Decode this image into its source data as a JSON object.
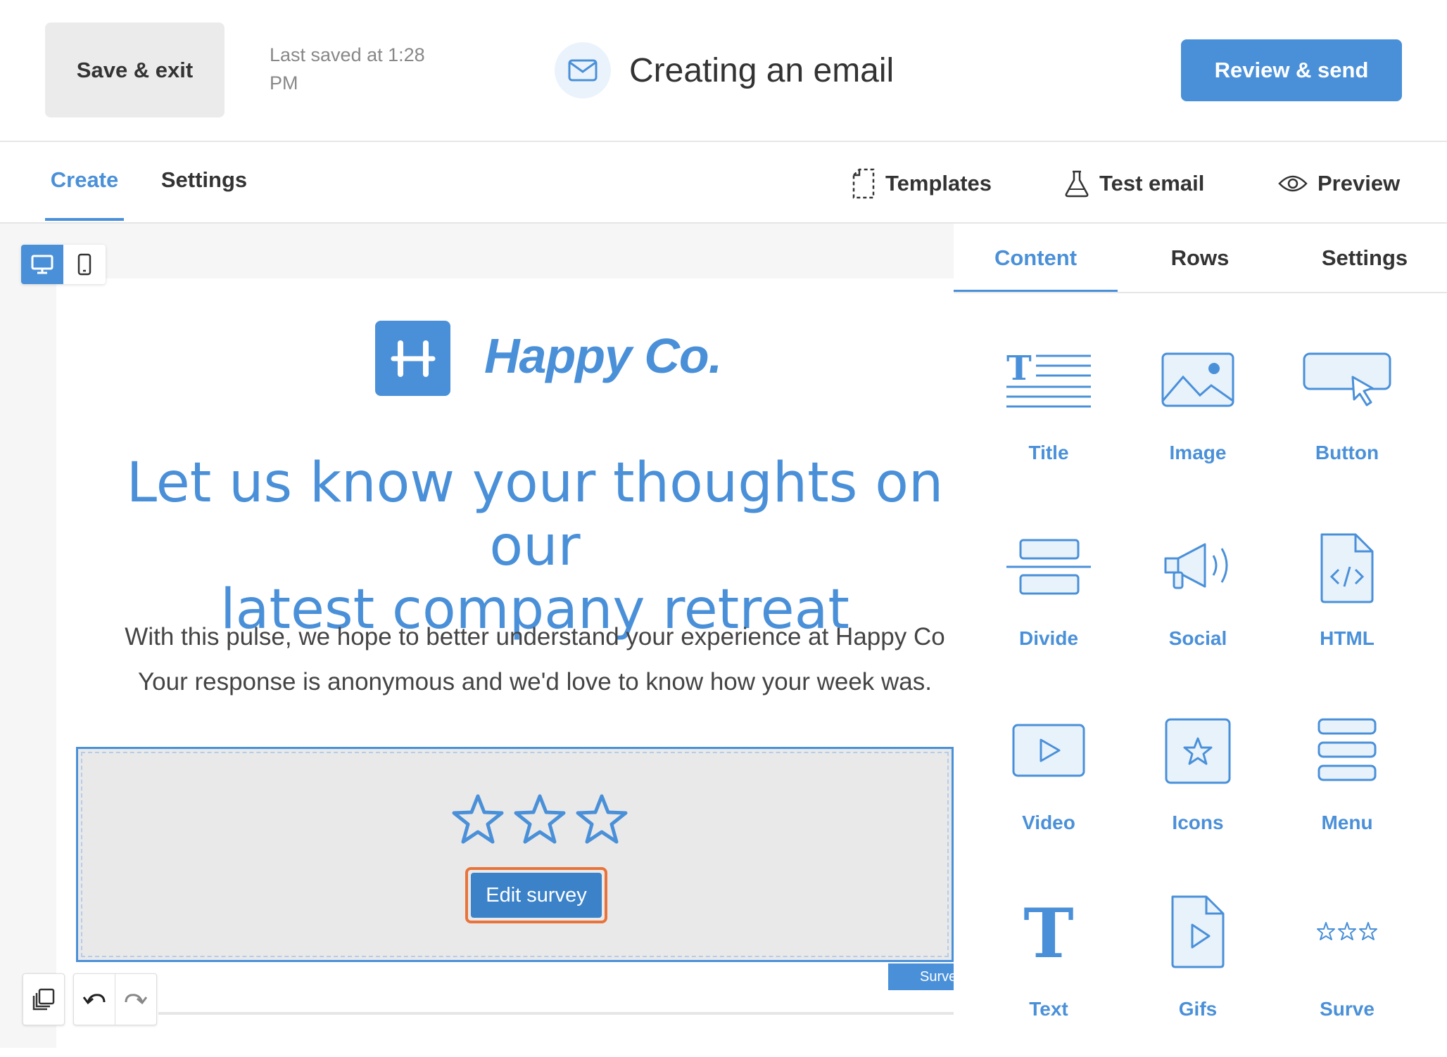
{
  "header": {
    "save_exit_label": "Save & exit",
    "last_saved": "Last saved at 1:28 PM",
    "title": "Creating an email",
    "review_send_label": "Review & send"
  },
  "tabs": {
    "create": "Create",
    "settings": "Settings"
  },
  "tools": {
    "templates": "Templates",
    "test_email": "Test email",
    "preview": "Preview"
  },
  "email": {
    "logo_text": "Happy Co.",
    "headline_line1": "Let us know your thoughts on our",
    "headline_line2": "latest company retreat",
    "body_line1": "With this pulse, we hope to better understand your experience at Happy Co",
    "body_line2": "Your response is anonymous and we'd love to know how your week was.",
    "edit_survey_label": "Edit survey",
    "survey_tag": "Surve"
  },
  "panel": {
    "tabs": [
      "Content",
      "Rows",
      "Settings"
    ],
    "active_tab": "Content",
    "items": [
      {
        "label": "Title",
        "icon": "title-icon"
      },
      {
        "label": "Image",
        "icon": "image-icon"
      },
      {
        "label": "Button",
        "icon": "button-icon"
      },
      {
        "label": "Divide",
        "icon": "divider-icon"
      },
      {
        "label": "Social",
        "icon": "megaphone-icon"
      },
      {
        "label": "HTML",
        "icon": "html-file-icon"
      },
      {
        "label": "Video",
        "icon": "video-icon"
      },
      {
        "label": "Icons",
        "icon": "star-icon"
      },
      {
        "label": "Menu",
        "icon": "menu-icon"
      },
      {
        "label": "Text",
        "icon": "text-icon"
      },
      {
        "label": "Gifs",
        "icon": "gif-file-icon"
      },
      {
        "label": "Surve",
        "icon": "survey-stars-icon"
      }
    ]
  },
  "colors": {
    "accent": "#4a90d9",
    "edit_survey_outline": "#e8743b",
    "icon_fill": "#e8f2fb"
  }
}
